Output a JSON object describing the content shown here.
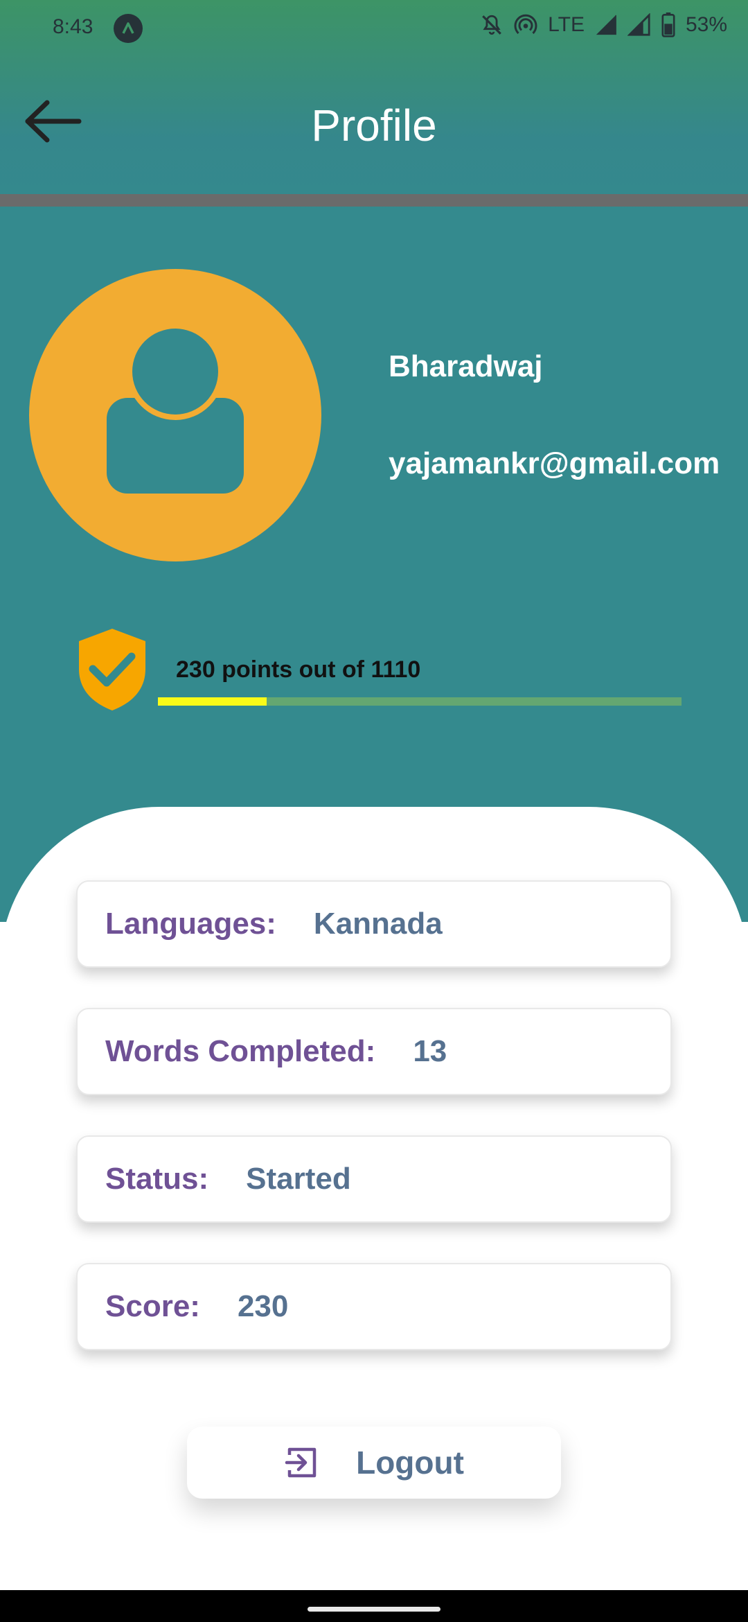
{
  "status_bar": {
    "time": "8:43",
    "network": "LTE",
    "battery": "53%",
    "icons": [
      "a-notification-icon",
      "mute-icon",
      "hotspot-icon",
      "signal-icon",
      "signal-icon",
      "battery-icon"
    ]
  },
  "app_bar": {
    "title": "Profile",
    "back_icon": "arrow-left-icon"
  },
  "profile": {
    "name": "Bharadwaj",
    "email": "yajamankr@gmail.com",
    "avatar_icon": "user-icon"
  },
  "points": {
    "text": "230 points out of 1110",
    "earned": 230,
    "total": 1110,
    "badge_icon": "shield-check-icon"
  },
  "cards": [
    {
      "label": "Languages:",
      "value": "Kannada"
    },
    {
      "label": "Words Completed:",
      "value": "13"
    },
    {
      "label": "Status:",
      "value": "Started"
    },
    {
      "label": "Score:",
      "value": "230"
    }
  ],
  "logout": {
    "label": "Logout",
    "icon": "logout-icon"
  },
  "colors": {
    "header_teal": "#348a8e",
    "avatar_orange": "#f2ac32",
    "label_purple": "#6f5195",
    "value_slate": "#567190",
    "progress_fill": "#fafb18",
    "progress_track": "#64a771"
  }
}
